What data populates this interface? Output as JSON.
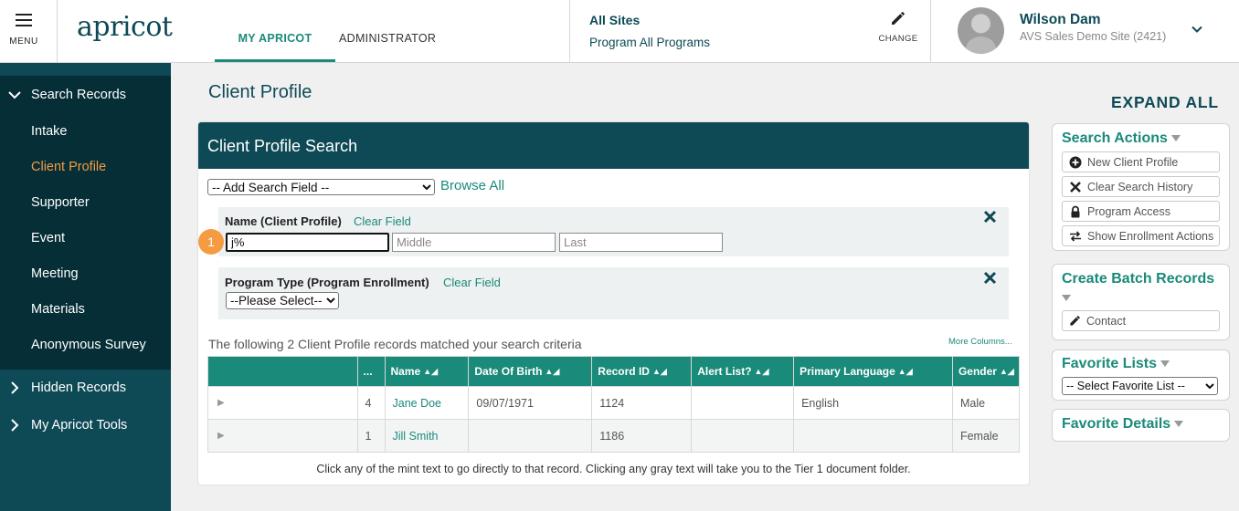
{
  "header": {
    "menu_label": "MENU",
    "logo": "apricot",
    "tabs": [
      {
        "label": "MY APRICOT",
        "active": true
      },
      {
        "label": "ADMINISTRATOR",
        "active": false
      }
    ],
    "site": "All Sites",
    "program": "Program All Programs",
    "change_label": "CHANGE",
    "user_name": "Wilson Dam",
    "user_site": "AVS Sales Demo Site (2421)"
  },
  "sidebar": {
    "groups": [
      {
        "label": "Search Records",
        "expanded": true,
        "items": [
          {
            "label": "Intake",
            "active": false
          },
          {
            "label": "Client Profile",
            "active": true
          },
          {
            "label": "Supporter",
            "active": false
          },
          {
            "label": "Event",
            "active": false
          },
          {
            "label": "Meeting",
            "active": false
          },
          {
            "label": "Materials",
            "active": false
          },
          {
            "label": "Anonymous Survey",
            "active": false
          }
        ]
      },
      {
        "label": "Hidden Records",
        "expanded": false
      },
      {
        "label": "My Apricot Tools",
        "expanded": false
      }
    ]
  },
  "main": {
    "page_title": "Client Profile",
    "panel_title": "Client Profile Search",
    "add_search_field": "-- Add Search Field --",
    "browse_all": "Browse All",
    "criteria": {
      "name": {
        "label": "Name (Client Profile)",
        "clear": "Clear Field",
        "first_value": "j%",
        "middle_placeholder": "Middle",
        "last_placeholder": "Last"
      },
      "program": {
        "label": "Program Type (Program Enrollment)",
        "clear": "Clear Field",
        "selected": "--Please Select--"
      }
    },
    "step_badge": "1",
    "match_text": "The following 2 Client Profile records matched your search criteria",
    "more_columns": "More Columns...",
    "table": {
      "columns": [
        "",
        "...",
        "Name",
        "Date Of Birth",
        "Record ID",
        "Alert List?",
        "Primary Language",
        "Gender"
      ],
      "rows": [
        {
          "count": "4",
          "name": "Jane Doe",
          "dob": "09/07/1971",
          "record_id": "1124",
          "alert": "",
          "language": "English",
          "gender": "Male"
        },
        {
          "count": "1",
          "name": "Jill Smith",
          "dob": "",
          "record_id": "1186",
          "alert": "",
          "language": "",
          "gender": "Female"
        }
      ]
    },
    "footnote": "Click any of the mint text to go directly to that record. Clicking any gray text will take you to the Tier 1 document folder."
  },
  "right": {
    "expand_all": "EXPAND ALL",
    "search_actions": {
      "title": "Search Actions",
      "buttons": [
        {
          "label": "New Client Profile",
          "icon": "plus-circle-icon"
        },
        {
          "label": "Clear Search History",
          "icon": "x-icon"
        },
        {
          "label": "Program Access",
          "icon": "lock-icon"
        },
        {
          "label": "Show Enrollment Actions",
          "icon": "swap-icon"
        }
      ]
    },
    "batch": {
      "title": "Create Batch Records",
      "button": "Contact"
    },
    "favorite_lists": {
      "title": "Favorite Lists",
      "selected": "-- Select Favorite List --"
    },
    "favorite_details": {
      "title": "Favorite Details"
    }
  },
  "colors": {
    "primary_dark": "#0e4a56",
    "sidebar_active_bg": "#052e36",
    "mint": "#1a8a7a",
    "accent_orange": "#f59b42"
  }
}
